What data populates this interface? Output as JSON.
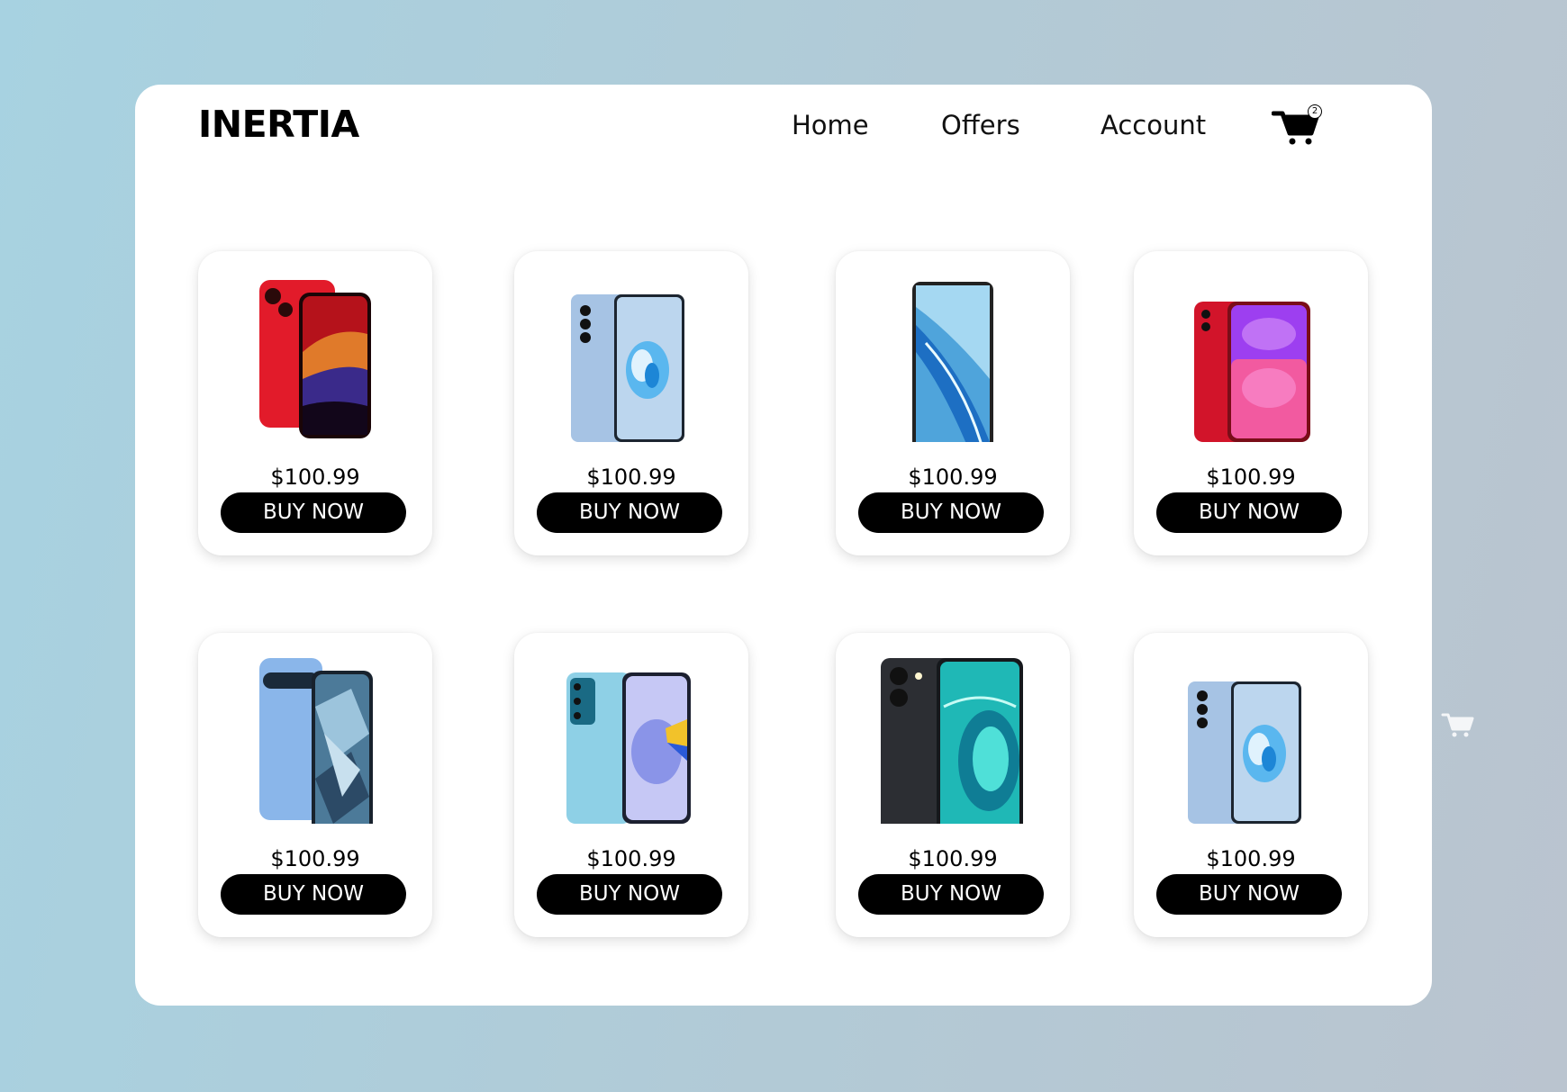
{
  "header": {
    "brand": "INERTIA",
    "nav": [
      {
        "label": "Home"
      },
      {
        "label": "Offers"
      },
      {
        "label": "Account"
      }
    ],
    "cart": {
      "icon": "cart-icon",
      "count": "2"
    }
  },
  "products": [
    {
      "image": "iphone-red-pair",
      "price": "$100.99",
      "button": "BUY NOW"
    },
    {
      "image": "vivo-blue-pair",
      "price": "$100.99",
      "button": "BUY NOW"
    },
    {
      "image": "android-blue-front",
      "price": "$100.99",
      "button": "BUY NOW"
    },
    {
      "image": "iphone-11-red",
      "price": "$100.99",
      "button": "BUY NOW"
    },
    {
      "image": "pixel-blue-pair",
      "price": "$100.99",
      "button": "BUY NOW"
    },
    {
      "image": "vivo-aqua-pair",
      "price": "$100.99",
      "button": "BUY NOW"
    },
    {
      "image": "vivo-black-pair",
      "price": "$100.99",
      "button": "BUY NOW"
    },
    {
      "image": "vivo-blue-pair",
      "price": "$100.99",
      "button": "BUY NOW"
    }
  ],
  "colors": {
    "accent": "#000000",
    "button_text": "#ffffff",
    "panel": "#ffffff"
  }
}
